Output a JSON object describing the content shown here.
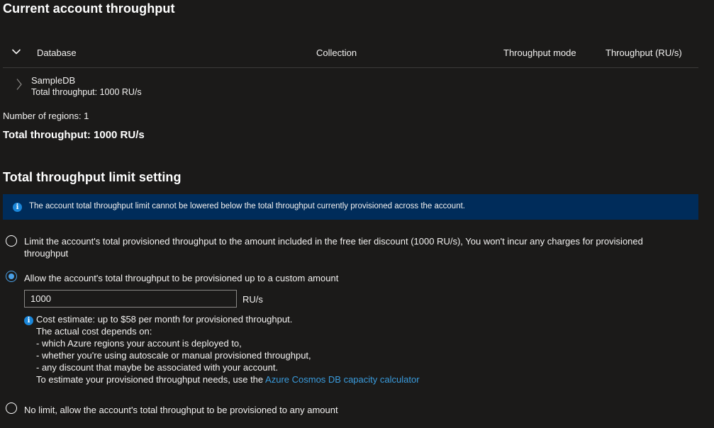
{
  "section1": {
    "title": "Current account throughput",
    "table": {
      "columns": [
        "Database",
        "Collection",
        "Throughput mode",
        "Throughput (RU/s)"
      ],
      "rows": [
        {
          "name": "SampleDB",
          "sub": "Total throughput: 1000 RU/s"
        }
      ]
    },
    "regions": "Number of regions: 1",
    "total": "Total throughput: 1000 RU/s"
  },
  "section2": {
    "title": "Total throughput limit setting",
    "banner": "The account total throughput limit cannot be lowered below the total throughput currently provisioned across the account.",
    "options": [
      {
        "label_line1": "Limit the account's total provisioned throughput to the amount included in the free tier discount (1000 RU/s), You won't incur any charges for provisioned",
        "label_line2": "throughput",
        "selected": false
      },
      {
        "label": "Allow the account's total throughput to be provisioned up to a custom amount",
        "selected": true
      },
      {
        "label": "No limit, allow the account's total throughput to be provisioned to any amount",
        "selected": false
      }
    ],
    "custom_amount": {
      "value": "1000",
      "unit": "RU/s"
    },
    "cost": {
      "line1": "Cost estimate: up to $58 per month for provisioned throughput.",
      "line2": "The actual cost depends on:",
      "line3": "- which Azure regions your account is deployed to,",
      "line4": "- whether you're using autoscale or manual provisioned throughput,",
      "line5": "- any discount that maybe be associated with your account.",
      "line6_prefix": "To estimate your provisioned throughput needs, use the ",
      "link": "Azure Cosmos DB capacity calculator"
    }
  },
  "colors": {
    "background": "#1b1a19",
    "banner": "#002c5a",
    "accent": "#4aa0e6",
    "link": "#3a9bdc"
  },
  "icons": [
    "chevron-down-icon",
    "chevron-right-icon",
    "info-icon"
  ]
}
